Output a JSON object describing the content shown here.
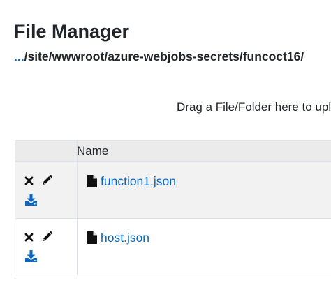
{
  "page": {
    "title": "File Manager",
    "breadcrumb": {
      "root_link": "...",
      "path": "/site/wwwroot/azure-webjobs-secrets/funcoct16/"
    },
    "drop_zone_text": "Drag a File/Folder here to upload"
  },
  "table": {
    "columns": [
      "",
      "Name"
    ],
    "rows": [
      {
        "name": "function1.json",
        "type_icon": "file-icon"
      },
      {
        "name": "host.json",
        "type_icon": "file-icon"
      }
    ]
  },
  "row_actions": {
    "icons": [
      "delete-icon",
      "edit-icon",
      "download-icon"
    ]
  },
  "colors": {
    "link": "#0b67c2",
    "header_bg": "#ebebeb",
    "odd_row_bg": "#f2f2f2",
    "border": "#dee2e6",
    "text": "#212529"
  }
}
